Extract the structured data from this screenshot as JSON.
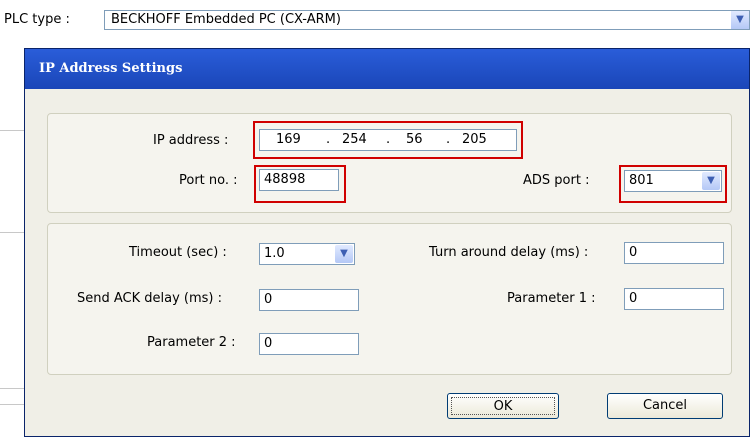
{
  "plc": {
    "label": "PLC type :",
    "value": "BECKHOFF Embedded PC (CX-ARM)"
  },
  "dialog": {
    "title": "IP Address Settings",
    "ip": {
      "label": "IP address :",
      "octets": [
        "169",
        "254",
        "56",
        "205"
      ],
      "separator": "."
    },
    "port": {
      "label": "Port no. :",
      "value": "48898"
    },
    "ads_port": {
      "label": "ADS port :",
      "value": "801"
    },
    "timeout": {
      "label": "Timeout (sec) :",
      "value": "1.0"
    },
    "turn_around": {
      "label": "Turn around delay (ms) :",
      "value": "0"
    },
    "send_ack": {
      "label": "Send ACK delay (ms) :",
      "value": "0"
    },
    "param1": {
      "label": "Parameter 1 :",
      "value": "0"
    },
    "param2": {
      "label": "Parameter 2 :",
      "value": "0"
    },
    "ok_label": "OK",
    "cancel_label": "Cancel"
  },
  "icons": {
    "dropdown": "chevron-down-icon"
  },
  "colors": {
    "title_bar": "#1a46b8",
    "highlight": "#d00000"
  }
}
